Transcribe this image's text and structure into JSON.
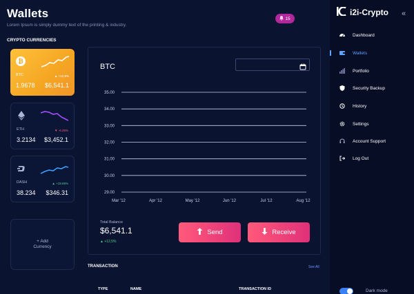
{
  "header": {
    "title": "Wallets",
    "subtitle": "Lorem Ipsum is simply dummy text of the printing & industry.",
    "notifications": "15"
  },
  "section_label": "CRYPTO CURRENCIES",
  "wallet_cards": [
    {
      "name": "BTC",
      "amount": "1.9678",
      "value": "$6,541.1",
      "change": "+12,8%",
      "icon": "bitcoin-icon",
      "trend_color": "#ffffff",
      "change_color": "#ffffff"
    },
    {
      "name": "ETH",
      "amount": "3.2134",
      "value": "$3,452.1",
      "change": "-6.25%",
      "icon": "ethereum-icon",
      "trend_color": "#a64dff",
      "change_color": "#ff5a7a"
    },
    {
      "name": "DASH",
      "amount": "38.234",
      "value": "$346.31",
      "change": "+19.69%",
      "icon": "dash-icon",
      "trend_color": "#3aa0ff",
      "change_color": "#4bd38a"
    }
  ],
  "add_card": {
    "line1": "+ Add",
    "line2": "Currency"
  },
  "panel": {
    "title": "BTC",
    "date_placeholder": "",
    "total_balance_label": "Total Balance",
    "total_balance": "$6,541.1",
    "change": "+12,5%",
    "send_label": "Send",
    "receive_label": "Receive"
  },
  "chart_data": {
    "type": "line",
    "title": "",
    "xlabel": "",
    "ylabel": "",
    "ylim": [
      29.0,
      35.0
    ],
    "y_ticks": [
      "35.00",
      "34.00",
      "33.00",
      "32.00",
      "31.00",
      "30.00",
      "29.00"
    ],
    "categories": [
      "Mar '12",
      "Apr '12",
      "May '12",
      "Jun '12",
      "Jul '12",
      "Aug '12"
    ],
    "series": [],
    "grid": true
  },
  "transactions": {
    "label": "TRANSACTION",
    "see_all": "See All",
    "columns": [
      "TYPE",
      "NAME",
      "TRANSACTION ID"
    ]
  },
  "sidebar": {
    "brand": "i2i-Crypto",
    "items": [
      {
        "label": "Dashboard",
        "icon": "dashboard-icon"
      },
      {
        "label": "Wallets",
        "icon": "wallet-icon"
      },
      {
        "label": "Portfolio",
        "icon": "portfolio-icon"
      },
      {
        "label": "Security Backup",
        "icon": "shield-icon"
      },
      {
        "label": "History",
        "icon": "history-icon"
      },
      {
        "label": "Settings",
        "icon": "gear-icon"
      },
      {
        "label": "Account Support",
        "icon": "headset-icon"
      },
      {
        "label": "Log Out",
        "icon": "logout-icon"
      }
    ],
    "dark_mode_label": "Dark mode"
  },
  "colors": {
    "accent": "#5ea2ff",
    "btc_card": "#f5a623",
    "button": "#e0307a",
    "background": "#0a1330"
  }
}
